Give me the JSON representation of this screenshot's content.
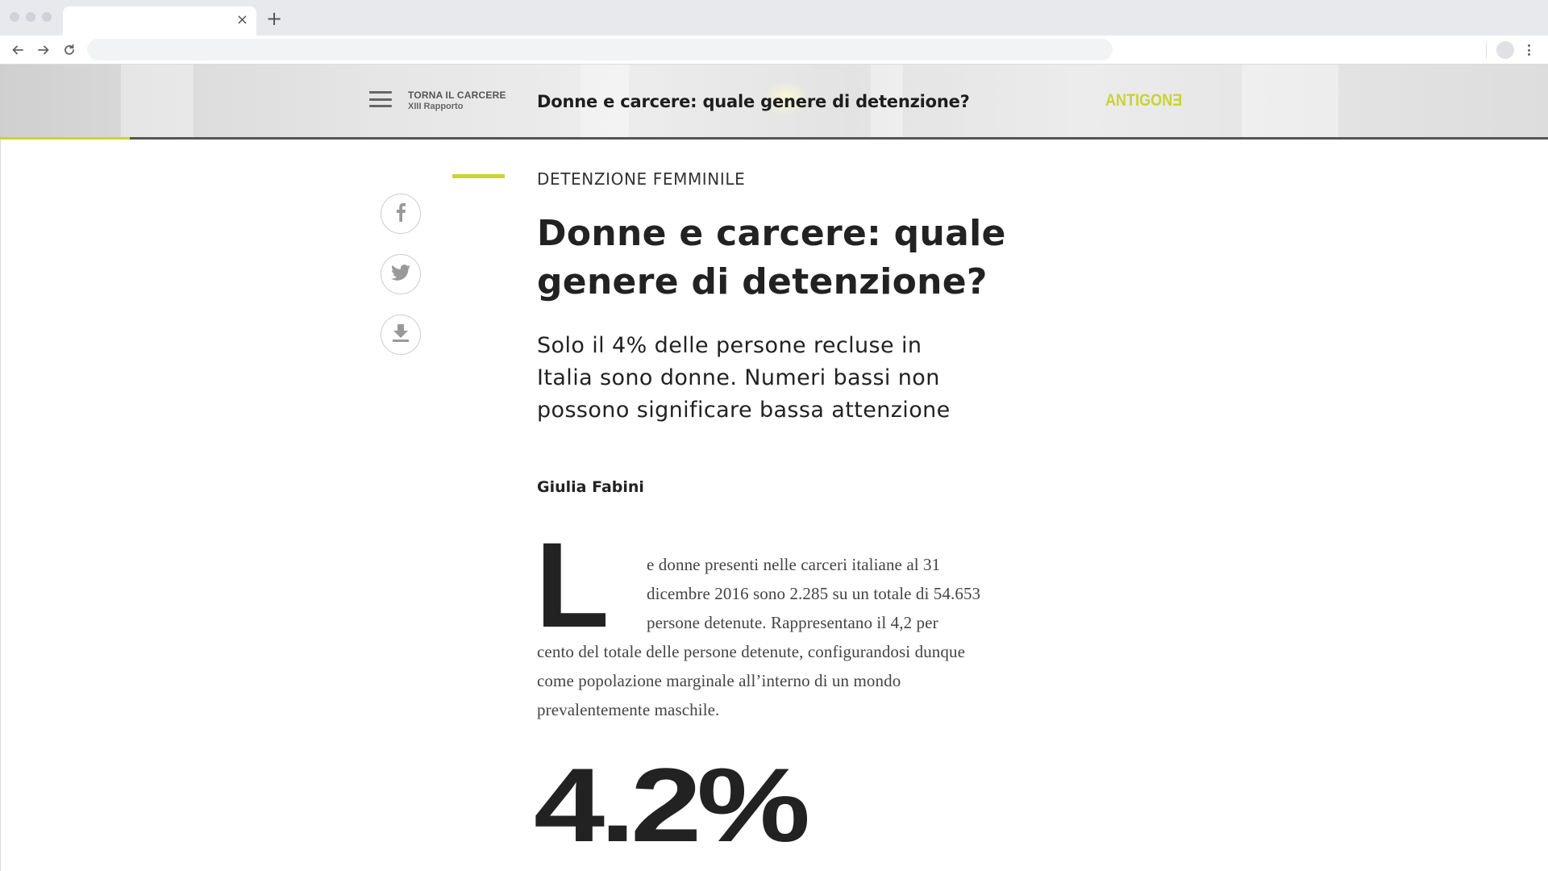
{
  "browser": {
    "tab_close_glyph": "×",
    "new_tab_glyph": "+",
    "omnibox_value": ""
  },
  "header": {
    "back_title": "TORNA IL CARCERE",
    "back_subtitle": "XIII Rapporto",
    "article_title": "Donne e carcere: quale genere di detenzione?",
    "brand": "ANTIGONƎ",
    "reading_progress_fraction": 0.084,
    "accent_color": "#c9d434"
  },
  "share": {
    "icons": [
      "facebook-icon",
      "twitter-icon",
      "download-icon"
    ]
  },
  "article": {
    "category": "DETENZIONE FEMMINILE",
    "title_line1": "Donne e carcere: quale",
    "title_line2": "genere di detenzione?",
    "subtitle_line1": "Solo il 4% delle persone recluse in",
    "subtitle_line2": "Italia sono donne. Numeri bassi non",
    "subtitle_line3": "possono significare bassa attenzione",
    "author": "Giulia Fabini",
    "dropcap": "L",
    "body_lines": [
      "e donne presenti nelle carceri italiane al 31",
      "dicembre 2016 sono 2.285 su un totale di 54.653",
      "persone detenute. Rappresentano il 4,2 per",
      "cento del totale delle persone detenute, configurandosi dunque",
      "come popolazione marginale all’interno di un mondo",
      "prevalentemente maschile."
    ],
    "big_stat": "4.2%"
  }
}
